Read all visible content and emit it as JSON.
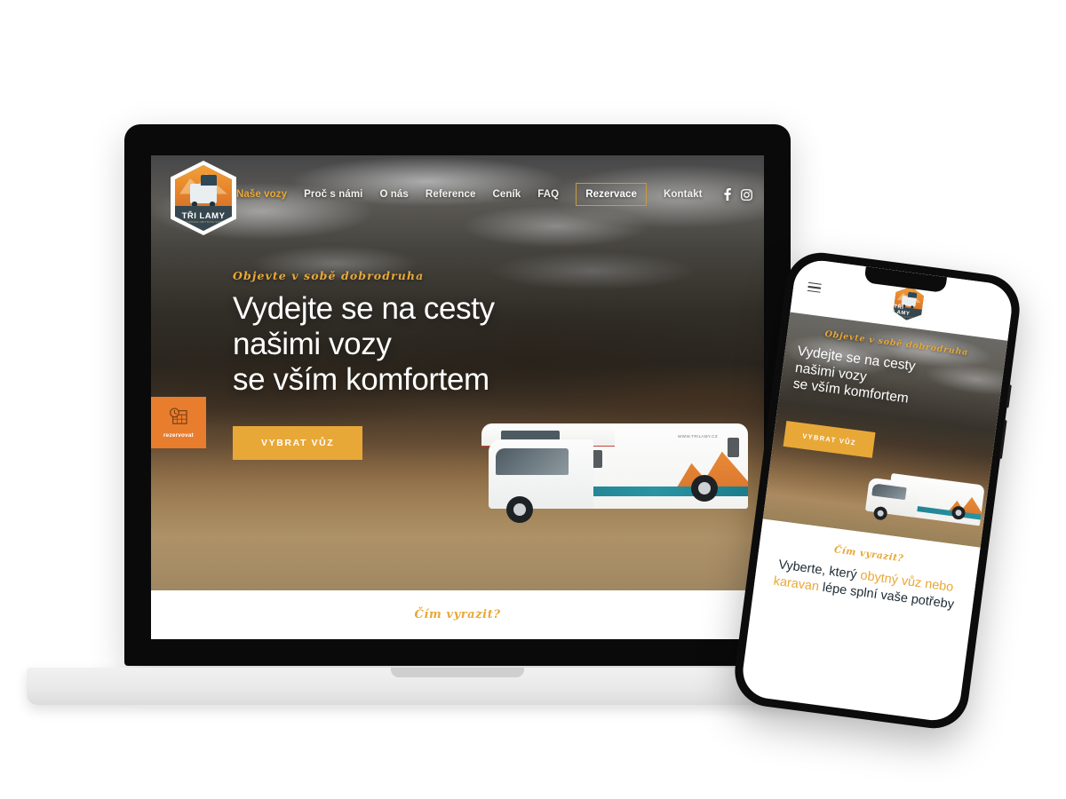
{
  "brand": {
    "logo_name": "TŘI LAMY",
    "logo_tagline": "PŮJČOVNA OBYTNÝCH VOZŮ",
    "accent_orange": "#e8a838",
    "accent_tab": "#e87d2e",
    "text_dark": "#1c2a33"
  },
  "desktop": {
    "nav": {
      "items": [
        {
          "label": "Naše vozy",
          "state": "active"
        },
        {
          "label": "Proč s námi",
          "state": "default"
        },
        {
          "label": "O nás",
          "state": "default"
        },
        {
          "label": "Reference",
          "state": "default"
        },
        {
          "label": "Ceník",
          "state": "default"
        },
        {
          "label": "FAQ",
          "state": "default"
        },
        {
          "label": "Rezervace",
          "state": "boxed"
        },
        {
          "label": "Kontakt",
          "state": "default"
        }
      ],
      "social": [
        {
          "name": "facebook-icon",
          "glyph": "f"
        },
        {
          "name": "instagram-icon",
          "glyph": "◉"
        }
      ]
    },
    "hero": {
      "eyebrow": "Objevte v sobě dobrodruha",
      "headline_line1": "Vydejte se na cesty",
      "headline_line2": "našimi vozy",
      "headline_line3": "se vším komfortem",
      "cta_label": "VYBRAT VŮZ"
    },
    "side_tab": {
      "label": "rezervovat",
      "icon": "calendar-clock-icon"
    },
    "vehicle": {
      "url_decal": "WWW.TRILAMY.CZ"
    },
    "band": {
      "title": "Čím vyrazit?"
    }
  },
  "mobile": {
    "header": {
      "menu_icon": "hamburger-menu-icon"
    },
    "hero": {
      "eyebrow": "Objevte v sobě dobrodruha",
      "headline_line1": "Vydejte se na cesty",
      "headline_line2": "našimi vozy",
      "headline_line3": "se vším komfortem",
      "cta_label": "VYBRAT VŮZ"
    },
    "band": {
      "title": "Čím vyrazit?",
      "sub_pre": "Vyberte, který ",
      "sub_hl": "obytný vůz nebo karavan",
      "sub_post": " lépe splní vaše potřeby"
    }
  }
}
